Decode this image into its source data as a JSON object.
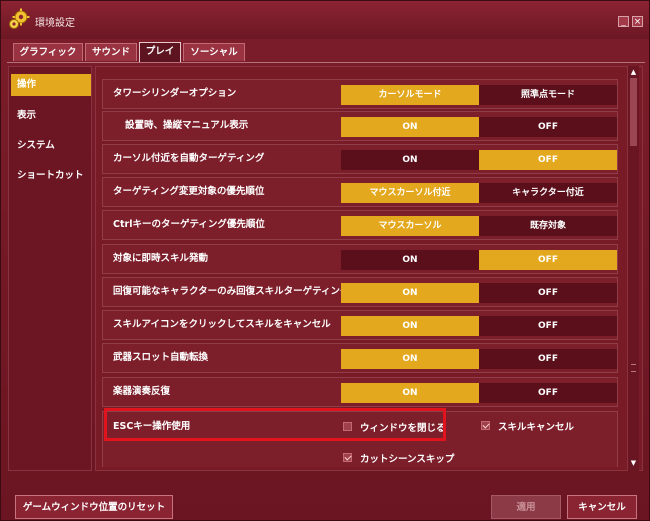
{
  "window": {
    "title": "環境設定",
    "minimize_label": "_",
    "close_label": "×"
  },
  "colors": {
    "accent": "#e3a81e",
    "off": "#5a0f1b",
    "highlight": "#e1141e",
    "bg": "#791a27"
  },
  "tabs": [
    {
      "label": "グラフィック",
      "active": false
    },
    {
      "label": "サウンド",
      "active": false
    },
    {
      "label": "プレイ",
      "active": true
    },
    {
      "label": "ソーシャル",
      "active": false
    }
  ],
  "sidebar": {
    "items": [
      {
        "label": "操作",
        "active": true
      },
      {
        "label": "表示",
        "active": false
      },
      {
        "label": "システム",
        "active": false
      },
      {
        "label": "ショートカット",
        "active": false
      }
    ]
  },
  "settings": [
    {
      "label": "タワーシリンダーオプション",
      "option_a": "カーソルモード",
      "option_b": "照準点モード",
      "selected": "a"
    },
    {
      "label": "設置時、操縦マニュアル表示",
      "option_a": "ON",
      "option_b": "OFF",
      "selected": "a"
    },
    {
      "label": "カーソル付近を自動ターゲティング",
      "option_a": "ON",
      "option_b": "OFF",
      "selected": "b"
    },
    {
      "label": "ターゲティング変更対象の優先順位",
      "option_a": "マウスカーソル付近",
      "option_b": "キャラクター付近",
      "selected": "a"
    },
    {
      "label": "Ctrlキーのターゲティング優先順位",
      "option_a": "マウスカーソル",
      "option_b": "既存対象",
      "selected": "a"
    },
    {
      "label": "対象に即時スキル発動",
      "option_a": "ON",
      "option_b": "OFF",
      "selected": "b"
    },
    {
      "label": "回復可能なキャラクターのみ回復スキルターゲティング",
      "option_a": "ON",
      "option_b": "OFF",
      "selected": "a"
    },
    {
      "label": "スキルアイコンをクリックしてスキルをキャンセル",
      "option_a": "ON",
      "option_b": "OFF",
      "selected": "a"
    },
    {
      "label": "武器スロット自動転換",
      "option_a": "ON",
      "option_b": "OFF",
      "selected": "a"
    },
    {
      "label": "楽器演奏反復",
      "option_a": "ON",
      "option_b": "OFF",
      "selected": "a"
    }
  ],
  "esc": {
    "label": "ESCキー操作使用",
    "close_window": {
      "label": "ウィンドウを閉じる",
      "checked": false
    },
    "skill_cancel": {
      "label": "スキルキャンセル",
      "checked": true
    },
    "cutscene_skip": {
      "label": "カットシーンスキップ",
      "checked": true
    }
  },
  "buttons": {
    "reset_position": "ゲームウィンドウ位置のリセット",
    "apply": "適用",
    "cancel": "キャンセル"
  },
  "icons": {
    "app": "gear-icon",
    "scroll_up": "arrow-up-icon",
    "scroll_down": "arrow-down-icon"
  }
}
